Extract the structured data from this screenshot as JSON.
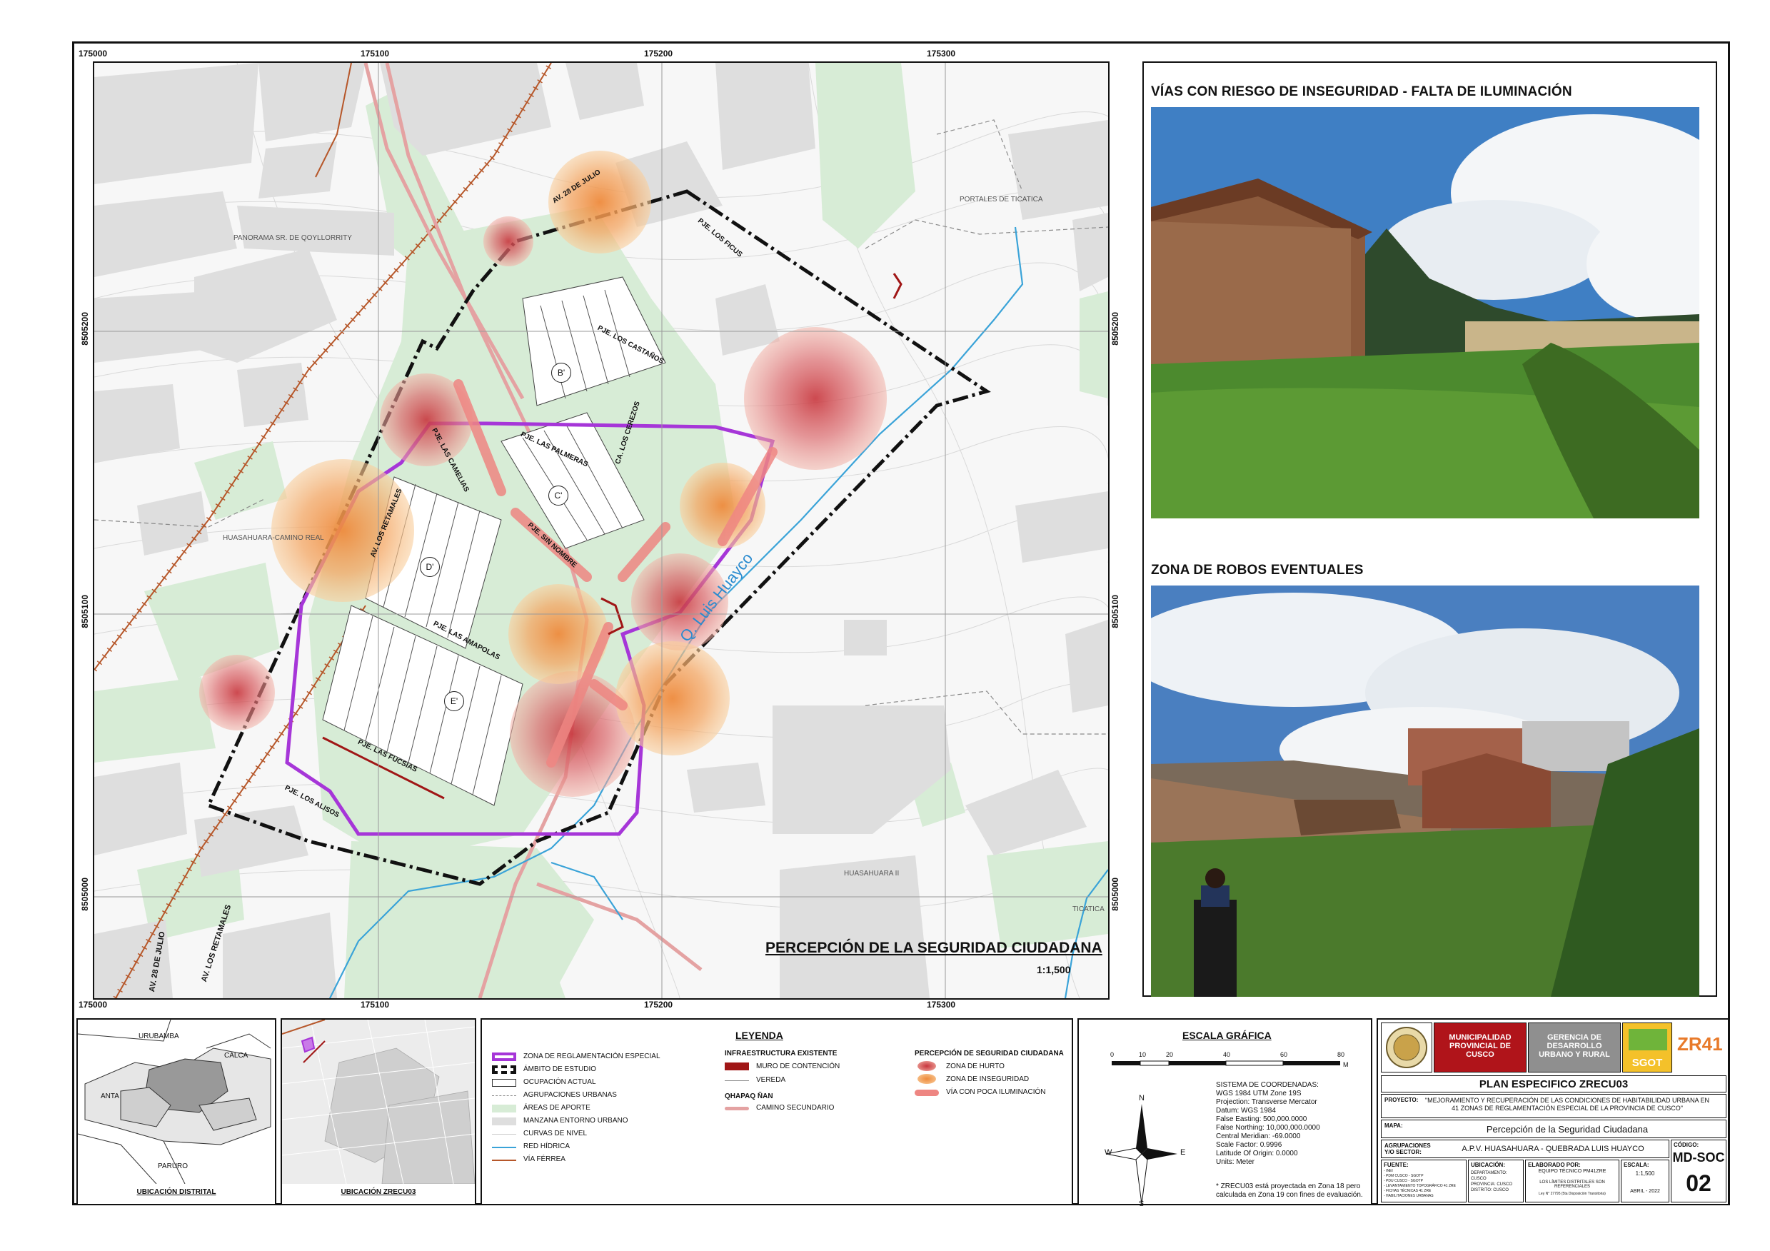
{
  "map": {
    "title": "PERCEPCIÓN DE LA SEGURIDAD CIUDADANA",
    "scale": "1:1,500",
    "coords_x": [
      "175000",
      "175100",
      "175200",
      "175300"
    ],
    "coords_y": [
      "8505200",
      "8505100",
      "8505000"
    ],
    "labels": {
      "panorama": "PANORAMA SR. DE QOYLLORRITY",
      "portales": "PORTALES DE TICATICA",
      "huasahuara_camino": "HUASAHUARA-CAMINO REAL",
      "huasahuara2": "HUASAHUARA II",
      "ticatica": "TICATICA",
      "quebrada": "Q. Luis Huayco",
      "av28_top": "AV. 28 DE JULIO",
      "av28_bottom": "AV. 28 DE JULIO",
      "retamales_top": "AV. LOS RETAMALES",
      "retamales_bottom": "AV. LOS RETAMALES",
      "ficus": "PJE. LOS FICUS",
      "castanos": "PJE. LOS CASTAÑOS",
      "cerezos": "CA. LOS CEREZOS",
      "palmeras": "PJE. LAS PALMERAS",
      "camelias": "PJE. LAS CAMELIAS",
      "sin_nombre": "PJE. SIN NOMBRE",
      "amapolas": "PJE. LAS AMAPOLAS",
      "fucsias": "PJE. LAS FUCSIAS",
      "alisos": "PJE. LOS ALISOS",
      "block_b": "B'",
      "block_c": "C'",
      "block_d": "D'",
      "block_e": "E'"
    }
  },
  "photos": {
    "top_title": "VÍAS CON RIESGO DE INSEGURIDAD - FALTA DE ILUMINACIÓN",
    "bottom_title": "ZONA DE ROBOS EVENTUALES"
  },
  "locator": {
    "district": {
      "caption": "UBICACIÓN DISTRITAL",
      "labels": [
        "URUBAMBA",
        "CALCA",
        "ANTA",
        "PARURO"
      ]
    },
    "zrecu": {
      "caption": "UBICACIÓN ZRECU03"
    }
  },
  "legend": {
    "title": "LEYENDA",
    "col1": [
      "ZONA DE REGLAMENTACIÓN ESPECIAL",
      "ÁMBITO DE ESTUDIO",
      "OCUPACIÓN ACTUAL",
      "AGRUPACIONES URBANAS",
      "ÁREAS DE APORTE",
      "MANZANA ENTORNO URBANO",
      "CURVAS DE NIVEL",
      "RED HÍDRICA",
      "VÍA FÉRREA"
    ],
    "col2_title": "INFRAESTRUCTURA EXISTENTE",
    "col2": [
      "MURO DE CONTENCIÓN",
      "VEREDA"
    ],
    "col2b_title": "QHAPAQ ÑAN",
    "col2b": [
      "CAMINO SECUNDARIO"
    ],
    "col3_title": "PERCEPCIÓN DE SEGURIDAD CIUDADANA",
    "col3": [
      "ZONA DE HURTO",
      "ZONA DE INSEGURIDAD",
      "VÍA CON POCA ILUMINACIÓN"
    ]
  },
  "scale_graphic": {
    "title": "ESCALA GRÁFICA",
    "ticks": [
      "0",
      "10",
      "20",
      "40",
      "60",
      "80"
    ],
    "unit": "M",
    "crs": [
      "SISTEMA DE COORDENADAS:",
      "WGS 1984 UTM Zone 19S",
      "Projection: Transverse Mercator",
      "Datum: WGS 1984",
      "False Easting: 500,000.0000",
      "False Northing: 10,000,000.0000",
      "Central Meridian: -69.0000",
      "Scale Factor: 0.9996",
      "Latitude Of Origin: 0.0000",
      "Units: Meter"
    ],
    "note": "* ZRECU03 está proyectada en Zona 18 pero calculada en Zona 19 con fines de evaluación.",
    "compass": {
      "n": "N",
      "s": "S",
      "e": "E",
      "w": "W"
    }
  },
  "title_block": {
    "muni": "MUNICIPALIDAD PROVINCIAL DE CUSCO",
    "gerencia": "GERENCIA DE DESARROLLO URBANO Y RURAL",
    "sgot": "SGOT",
    "zr": "ZR41",
    "plan": "PLAN ESPECIFICO ZRECU03",
    "proyecto_label": "PROYECTO:",
    "proyecto": "\"MEJORAMIENTO Y RECUPERACIÓN DE LAS CONDICIONES DE HABITABILIDAD URBANA EN 41 ZONAS DE REGLAMENTACIÓN ESPECIAL DE LA PROVINCIA DE CUSCO\"",
    "mapa_label": "MAPA:",
    "mapa": "Percepción de la Seguridad Ciudadana",
    "agrup_label": "AGRUPACIONES Y/O SECTOR:",
    "agrup": "A.P.V. HUASAHUARA - QUEBRADA LUIS HUAYCO",
    "codigo_label": "CÓDIGO:",
    "codigo1": "MD-SOC",
    "codigo2": "02",
    "fuente_label": "FUENTE:",
    "fuente": [
      "- INEI",
      "- PDM CUSCO - SGOTP",
      "- PDU CUSCO - SGOTP",
      "- LEVANTAMIENTO TOPOGRÁFICO 41 ZRE",
      "- FICHAS TÉCNICAS 41 ZRE",
      "- HABILITACIONES URBANAS"
    ],
    "ubicacion_label": "UBICACIÓN:",
    "ubicacion": [
      [
        "DEPARTAMENTO:",
        "CUSCO"
      ],
      [
        "PROVINCIA:",
        "CUSCO"
      ],
      [
        "DISTRITO:",
        "CUSCO"
      ]
    ],
    "elaborado_label": "ELABORADO POR:",
    "elaborado": "EQUIPO TÉCNICO PM41ZRE",
    "limites": "LOS LÍMITES DISTRITALES SON REFERENCIALES",
    "ley": "Ley N° 27795 (5ta Disposición Transitoria)",
    "escala_label": "ESCALA:",
    "escala": "1:1,500",
    "fecha": "ABRIL - 2022"
  }
}
